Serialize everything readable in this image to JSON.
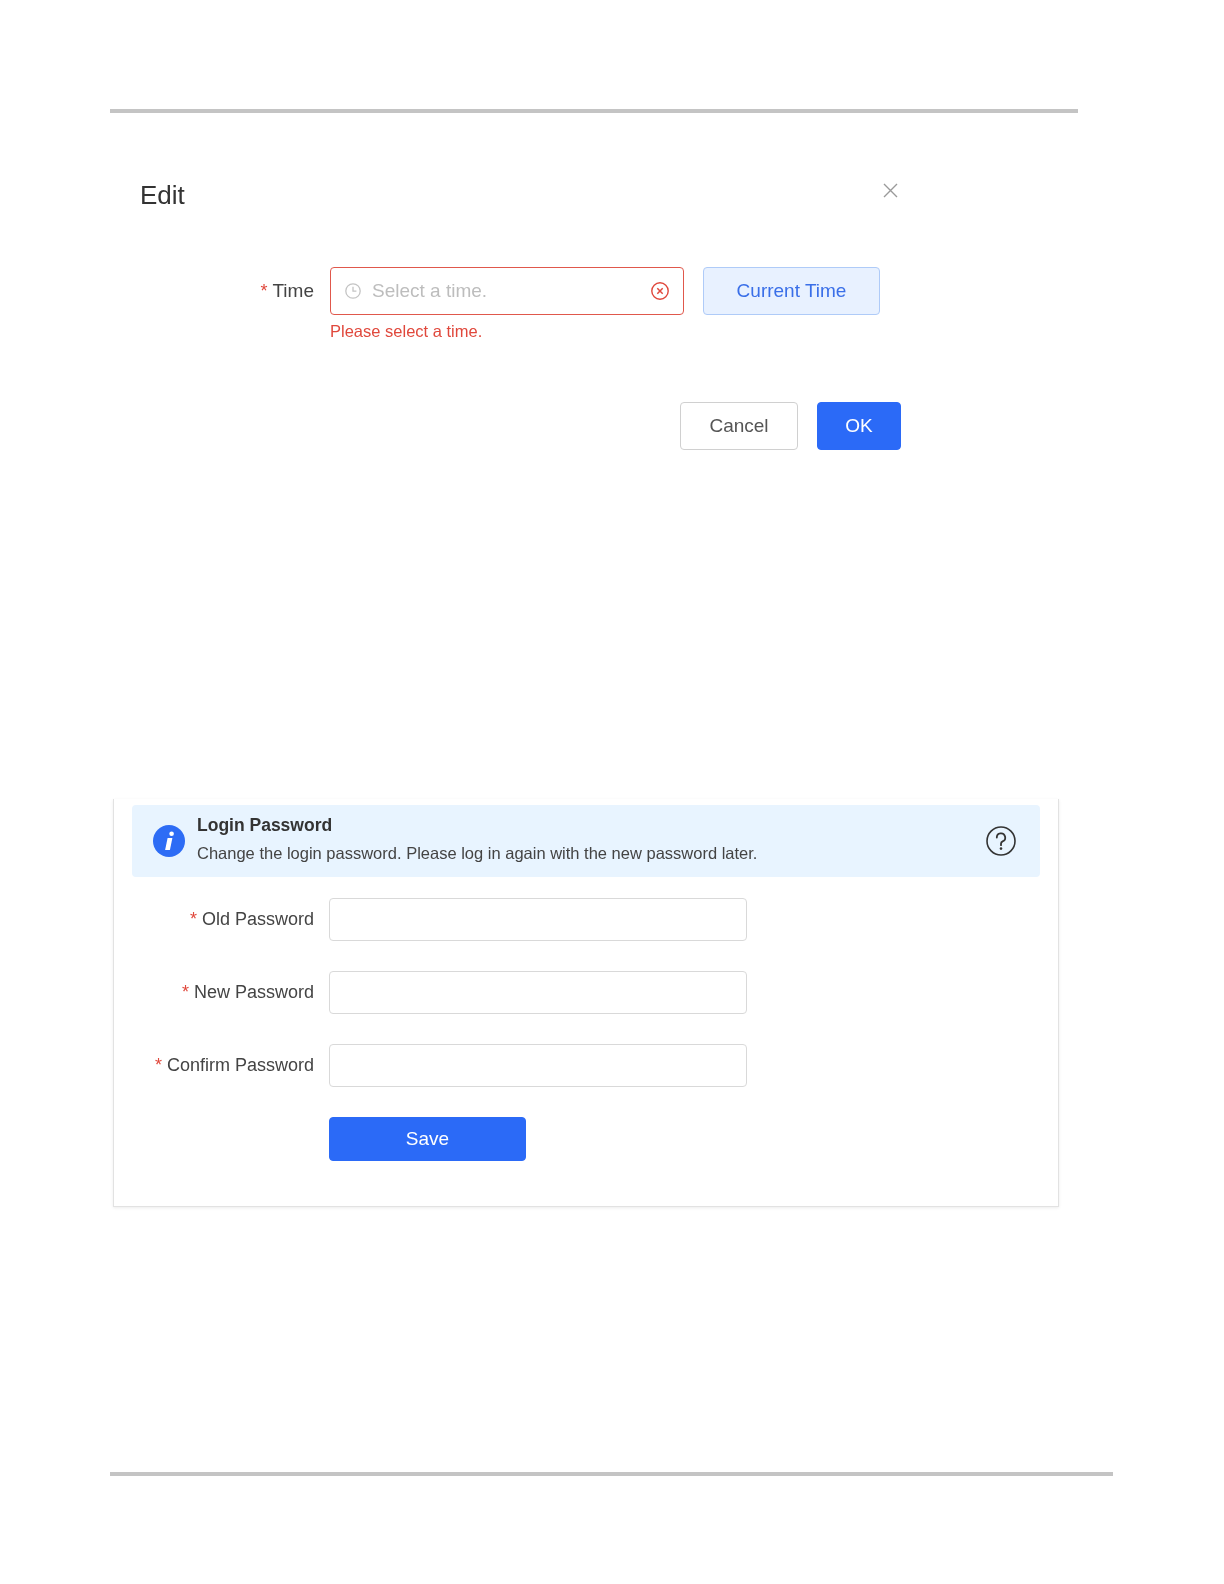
{
  "dialog": {
    "title": "Edit",
    "fields": [
      {
        "label": "Time",
        "required_mark": "*",
        "placeholder": "Select a time.",
        "error": "Please select a time.",
        "button": {
          "label": "Current Time",
          "kind": "secondary"
        }
      }
    ],
    "actions": [
      {
        "label": "Cancel",
        "kind": "default"
      },
      {
        "label": "OK",
        "kind": "primary"
      }
    ]
  },
  "login_password": {
    "banner": {
      "title": "Login Password",
      "description": "Change the login password. Please log in again with the new password later."
    },
    "fields": [
      {
        "label": "Old Password",
        "required_mark": "*"
      },
      {
        "label": "New Password",
        "required_mark": "*"
      },
      {
        "label": "Confirm Password",
        "required_mark": "*"
      }
    ],
    "actions": [
      {
        "label": "Save",
        "kind": "primary"
      }
    ]
  }
}
